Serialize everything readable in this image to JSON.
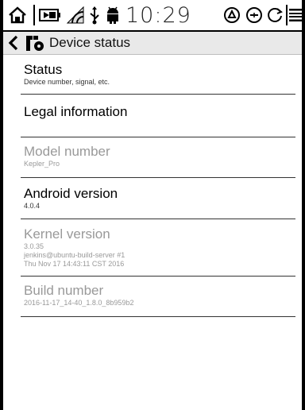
{
  "statusbar": {
    "time": "10:29",
    "icons": [
      "home-icon",
      "battery-icon",
      "wifi-icon",
      "usb-icon",
      "android-icon",
      "sync-icon",
      "zoom-icon",
      "refresh-icon",
      "menu-icon"
    ]
  },
  "titlebar": {
    "title": "Device status"
  },
  "items": [
    {
      "title": "Status",
      "subtitle": "Device number, signal, etc.",
      "enabled": true
    },
    {
      "title": "Legal information",
      "enabled": true
    },
    {
      "title": "Model number",
      "subtitle": "Kepler_Pro",
      "enabled": false
    },
    {
      "title": "Android version",
      "subtitle": "4.0.4",
      "enabled": true
    },
    {
      "title": "Kernel version",
      "subtitle_lines": [
        "3.0.35",
        "jenkins@ubuntu-build-server #1",
        "Thu Nov 17 14:43:11 CST 2016"
      ],
      "enabled": false
    },
    {
      "title": "Build number",
      "subtitle": "2016-11-17_14-40_1.8.0_8b959b2",
      "enabled": false
    }
  ]
}
